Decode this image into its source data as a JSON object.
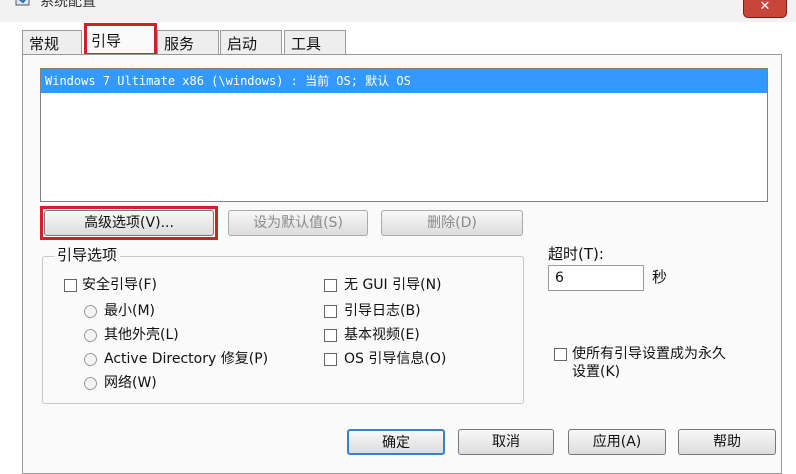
{
  "window": {
    "title": "系统配置",
    "close_glyph": "✕"
  },
  "tabs": [
    {
      "label": "常规"
    },
    {
      "label": "引导"
    },
    {
      "label": "服务"
    },
    {
      "label": "启动"
    },
    {
      "label": "工具"
    }
  ],
  "boot_list": {
    "items": [
      "Windows 7 Ultimate x86 (\\windows) : 当前 OS; 默认 OS"
    ],
    "selected_index": 0
  },
  "buttons": {
    "advanced": "高级选项(V)...",
    "set_default": "设为默认值(S)",
    "delete": "删除(D)"
  },
  "boot_options": {
    "title": "引导选项",
    "safe_boot": "安全引导(F)",
    "minimal": "最小(M)",
    "alternate_shell": "其他外壳(L)",
    "active_directory": "Active Directory 修复(P)",
    "network": "网络(W)",
    "no_gui": "无 GUI 引导(N)",
    "boot_log": "引导日志(B)",
    "base_video": "基本视频(E)",
    "os_boot_info": "OS 引导信息(O)"
  },
  "timeout": {
    "label": "超时(T):",
    "value": "6",
    "unit": "秒"
  },
  "permanent": {
    "line1": "使所有引导设置成为永久",
    "line2": "设置(K)"
  },
  "footer": {
    "ok": "确定",
    "cancel": "取消",
    "apply": "应用(A)",
    "help": "帮助"
  },
  "icons": {
    "app": "system-config-icon",
    "close": "close-icon",
    "checkbox": "checkbox-icon",
    "radio": "radio-icon"
  },
  "colors": {
    "selection": "#3399ff",
    "highlight_annotation": "#d0202a",
    "close_button": "#c7453a"
  }
}
